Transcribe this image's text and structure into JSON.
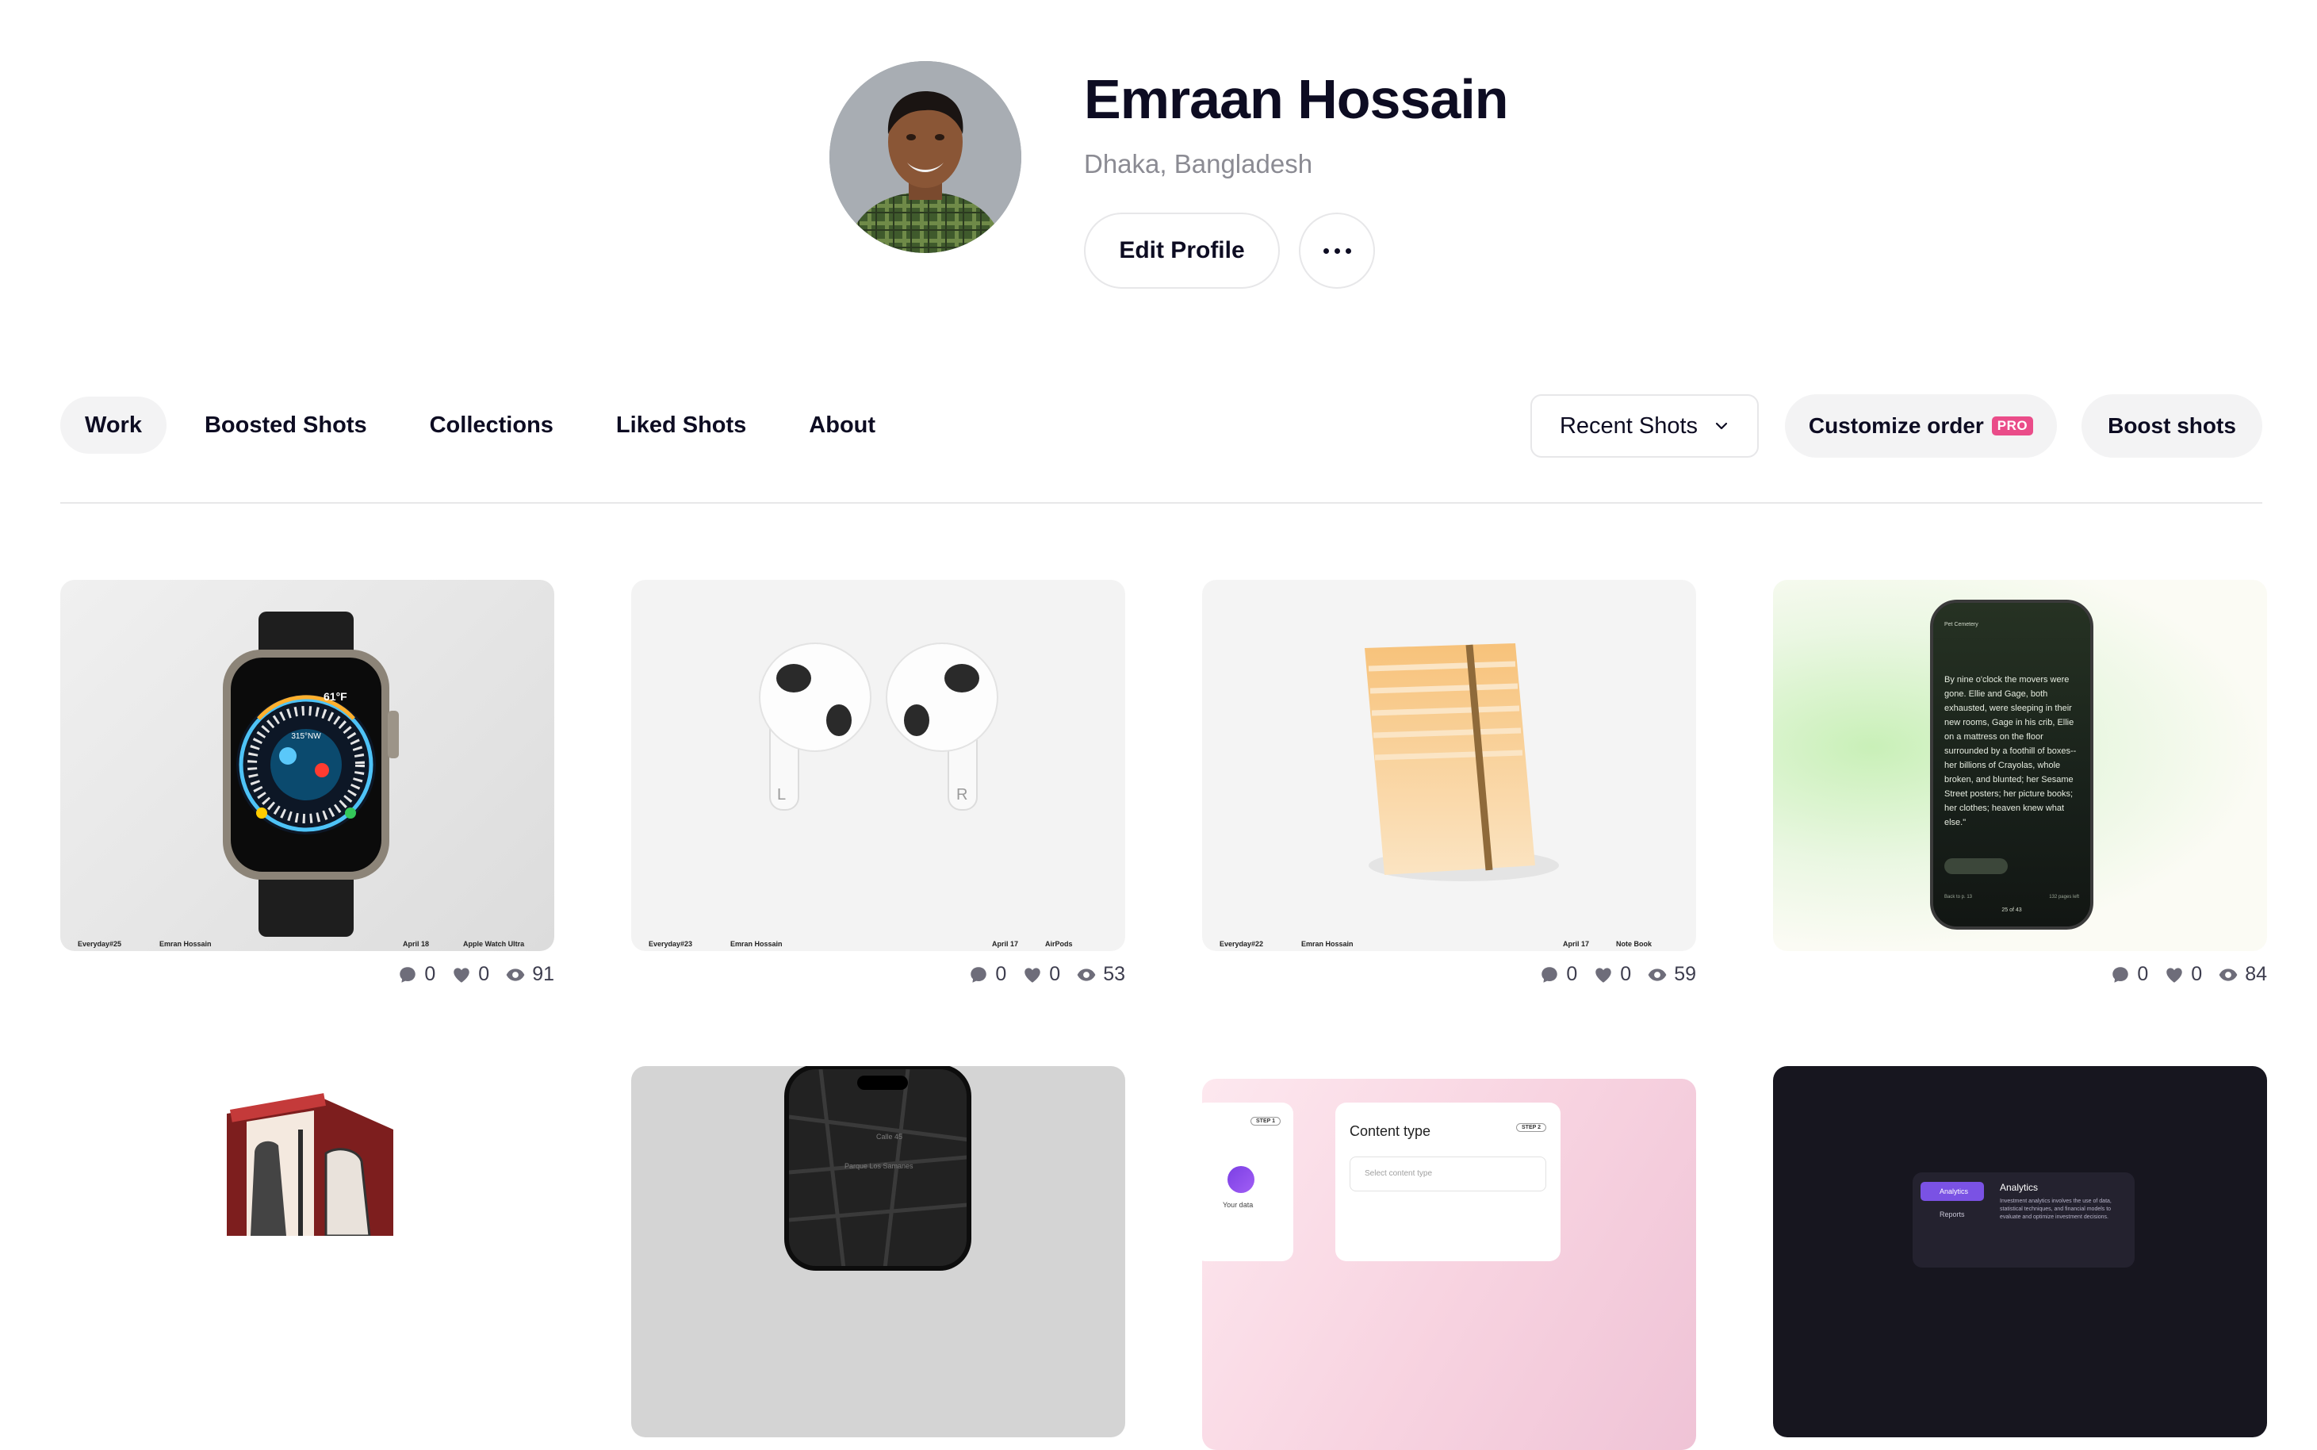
{
  "profile": {
    "name": "Emraan Hossain",
    "location": "Dhaka, Bangladesh",
    "edit_label": "Edit Profile"
  },
  "tabs": [
    {
      "label": "Work",
      "active": true
    },
    {
      "label": "Boosted Shots",
      "active": false
    },
    {
      "label": "Collections",
      "active": false
    },
    {
      "label": "Liked Shots",
      "active": false
    },
    {
      "label": "About",
      "active": false
    }
  ],
  "toolbar": {
    "sort_label": "Recent Shots",
    "customize_label": "Customize order",
    "pro_badge": "PRO",
    "boost_label": "Boost shots"
  },
  "shots": [
    {
      "caption": [
        "Everyday#25",
        "Emran Hossain",
        "April 18",
        "Apple Watch Ultra"
      ],
      "comments": "0",
      "likes": "0",
      "views": "91"
    },
    {
      "caption": [
        "Everyday#23",
        "Emran Hossain",
        "April 17",
        "AirPods"
      ],
      "comments": "0",
      "likes": "0",
      "views": "53"
    },
    {
      "caption": [
        "Everyday#22",
        "Emran Hossain",
        "April 17",
        "Note Book"
      ],
      "comments": "0",
      "likes": "0",
      "views": "59"
    },
    {
      "caption": [],
      "comments": "0",
      "likes": "0",
      "views": "84"
    }
  ],
  "shot_contents": {
    "watch_complication_top": "61°F",
    "airpods_left": "L",
    "airpods_right": "R",
    "ebook_header": "Pet Cemetery",
    "ebook_text": "By nine o'clock the movers were gone. Ellie and Gage, both exhausted, were sleeping in their new rooms, Gage in his crib, Ellie on a mattress on the floor surrounded by a foothill of boxes--her billions of Crayolas, whole broken, and blunted; her Sesame Street posters; her picture books; her clothes; heaven knew what else.\"",
    "ebook_footer_left": "Back to p. 13",
    "ebook_footer_right": "132 pages left",
    "ebook_page": "25 of 43",
    "map_street": "Calle 45",
    "map_park": "Parque Los Samanes",
    "form_step1": "STEP 1",
    "form_step2": "STEP 2",
    "form_title": "Content type",
    "form_placeholder": "Select content type",
    "form_your_data": "Your data",
    "analytics_nav1": "Analytics",
    "analytics_nav2": "Reports",
    "analytics_title": "Analytics",
    "analytics_desc": "Investment analytics involves the use of data, statistical techniques, and financial models to evaluate and optimize investment decisions."
  },
  "colors": {
    "accent_pink": "#ea4c89",
    "text_dark": "#0d0c22",
    "muted": "#8b8b93"
  }
}
